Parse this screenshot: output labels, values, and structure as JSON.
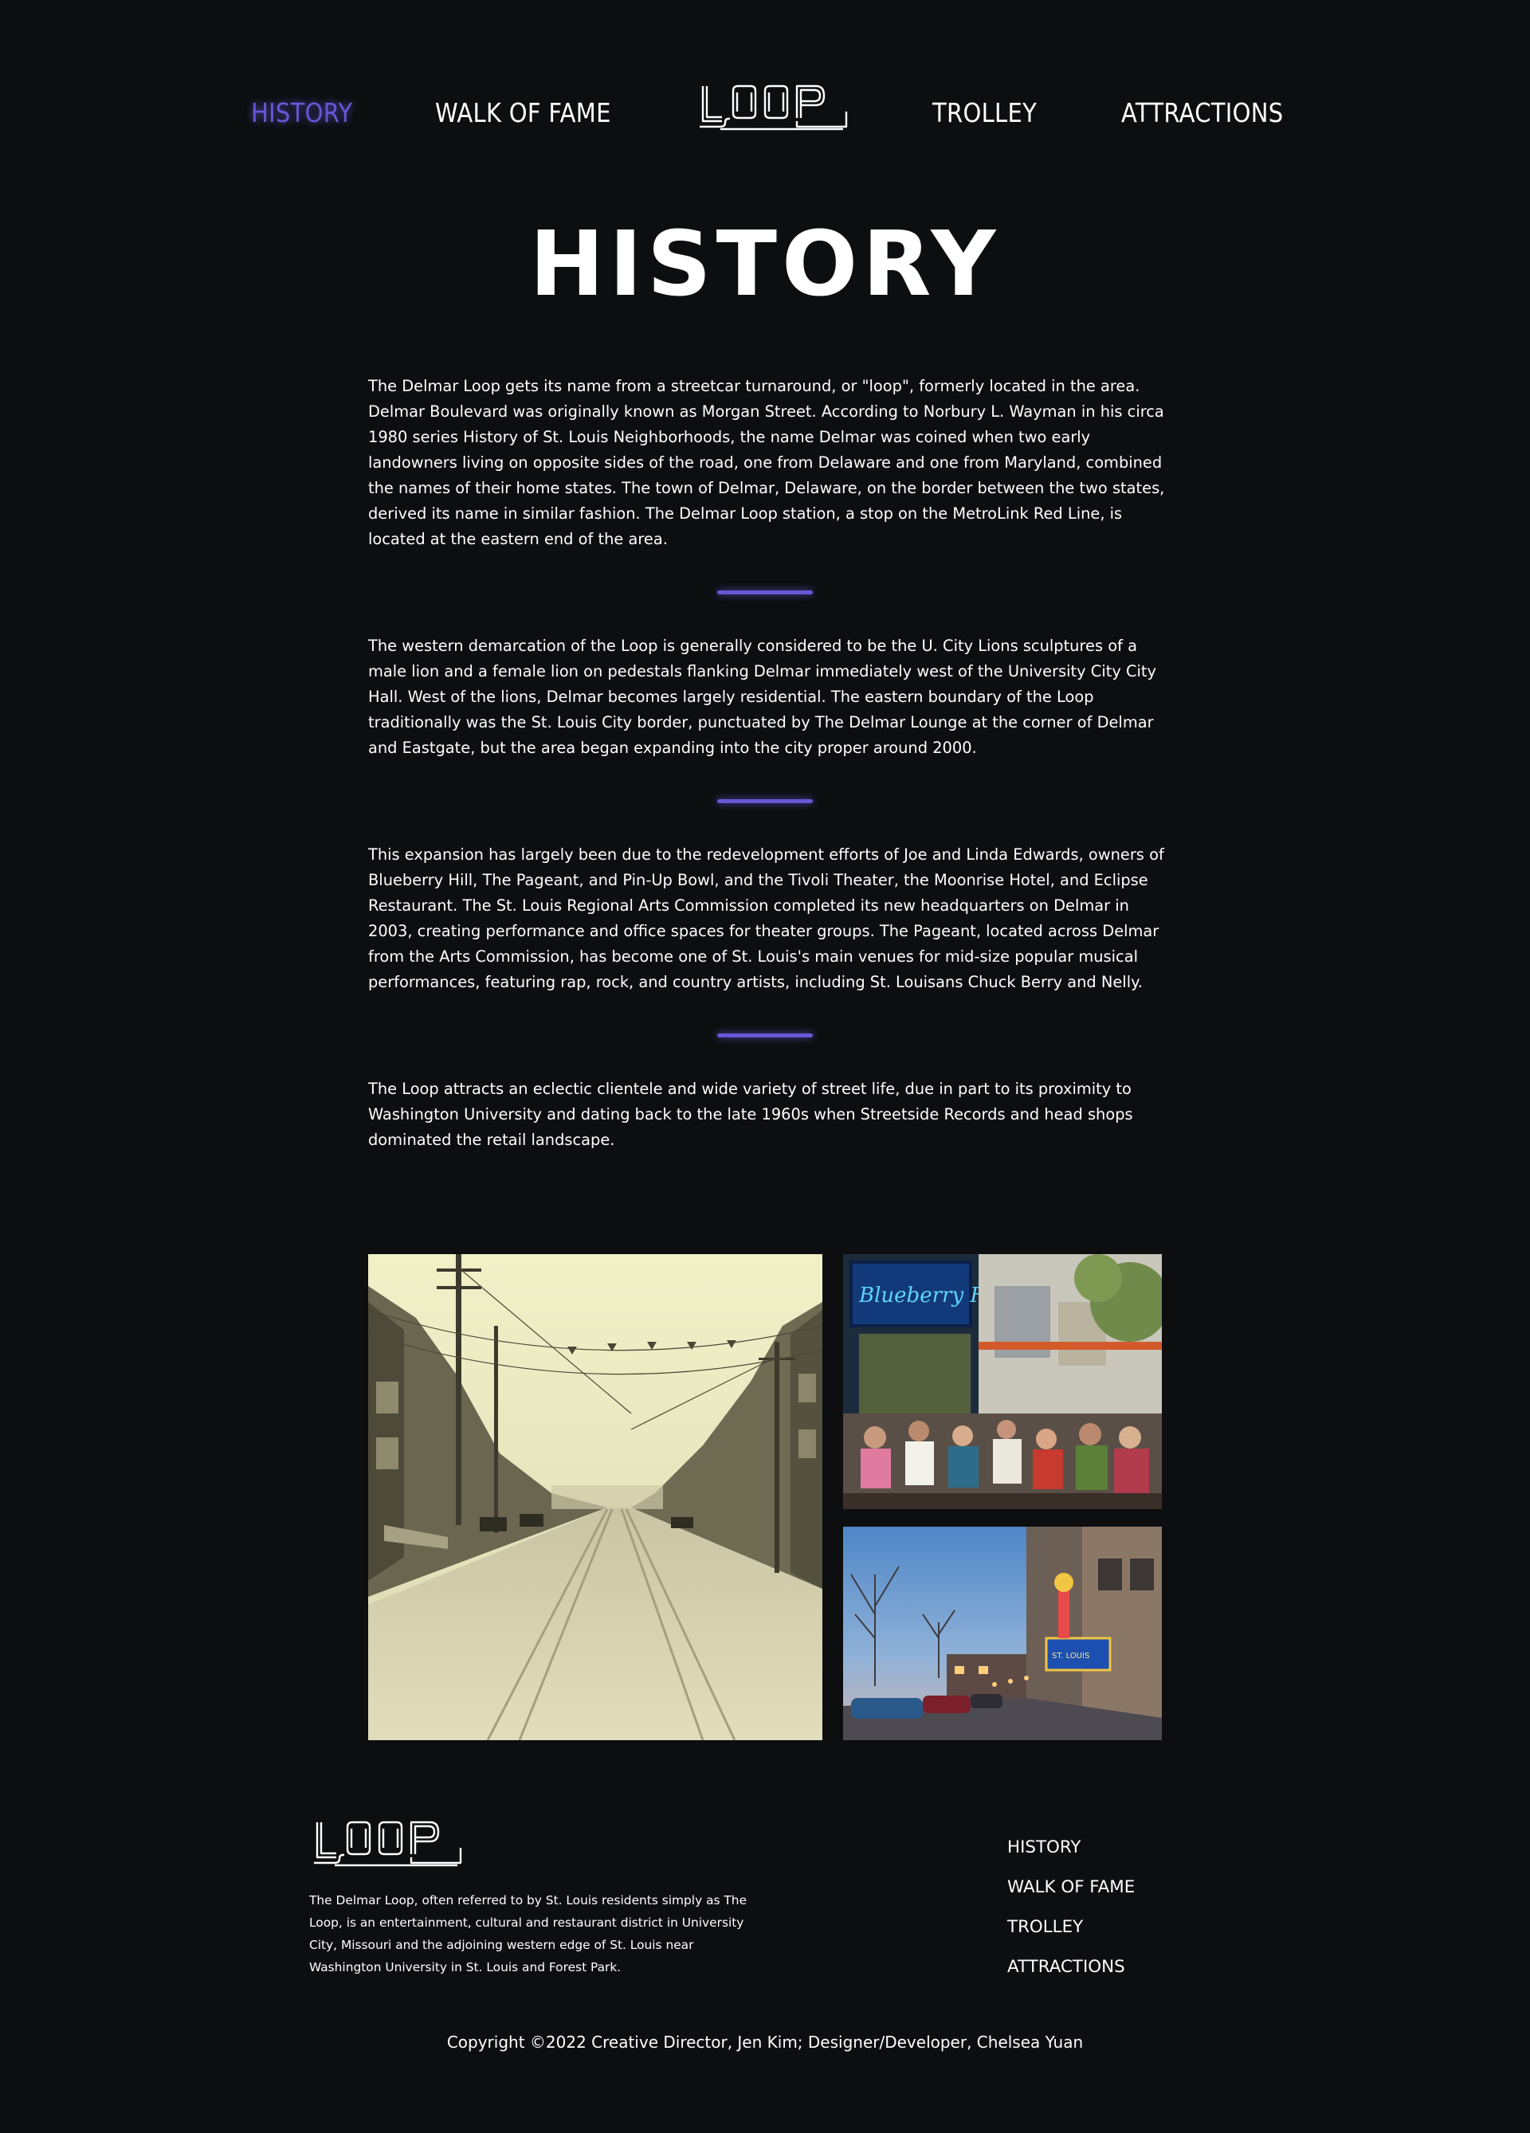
{
  "nav": {
    "items": [
      {
        "label": "HISTORY",
        "active": true
      },
      {
        "label": "WALK OF FAME",
        "active": false
      },
      {
        "label": "TROLLEY",
        "active": false
      },
      {
        "label": "ATTRACTIONS",
        "active": false
      }
    ],
    "logo_text": "LOOP"
  },
  "page_title": "HISTORY",
  "paragraphs": [
    "The Delmar Loop gets its name from a streetcar turnaround, or \"loop\", formerly located in the area. Delmar Boulevard was originally known as Morgan Street. According to Norbury L. Wayman in his circa 1980 series History of St. Louis Neighborhoods, the name Delmar was coined when two early landowners living on opposite sides of the road, one from Delaware and one from Maryland, combined the names of their home states. The town of Delmar, Delaware, on the border between the two states, derived its name in similar fashion. The Delmar Loop station, a stop on the MetroLink Red Line, is located at the eastern end of the area.",
    "The western demarcation of the Loop is generally considered to be the U. City Lions sculptures of a male lion and a female lion on pedestals flanking Delmar immediately west of the University City City Hall. West of the lions, Delmar becomes largely residential. The eastern boundary of the Loop traditionally was the St. Louis City border, punctuated by The Delmar Lounge at the corner of Delmar and Eastgate, but the area began expanding into the city proper around 2000.",
    "This expansion has largely been due to the redevelopment efforts of Joe and Linda Edwards, owners of Blueberry Hill, The Pageant, and Pin-Up Bowl, and the Tivoli Theater, the Moonrise Hotel, and Eclipse Restaurant. The St. Louis Regional Arts Commission completed its new headquarters on Delmar in 2003, creating performance and office spaces for theater groups. The Pageant, located across Delmar from the Arts Commission, has become one of St. Louis's main venues for mid-size popular musical performances, featuring rap, rock, and country artists, including St. Louisans Chuck Berry and Nelly.",
    "The Loop attracts an eclectic clientele and wide variety of street life, due in part to its proximity to Washington University and dating back to the late 1960s when Streetside Records and head shops dominated the retail landscape."
  ],
  "photos": {
    "main_sign_text": "Blueberry Hill",
    "theater_sign_text": "ST. LOUIS"
  },
  "footer": {
    "logo_text": "LOOP",
    "description": "The Delmar Loop, often referred to by St. Louis residents simply as The Loop, is an entertainment, cultural and restaurant district in University City, Missouri and the adjoining western edge of St. Louis near Washington University in St. Louis and Forest Park.",
    "links": [
      "HISTORY",
      "WALK OF FAME",
      "TROLLEY",
      "ATTRACTIONS"
    ],
    "copyright": "Copyright ©2022 Creative Director, Jen Kim; Designer/Developer, Chelsea Yuan"
  },
  "colors": {
    "background": "#0d0e10",
    "accent": "#6a56d6",
    "text": "#ffffff"
  }
}
